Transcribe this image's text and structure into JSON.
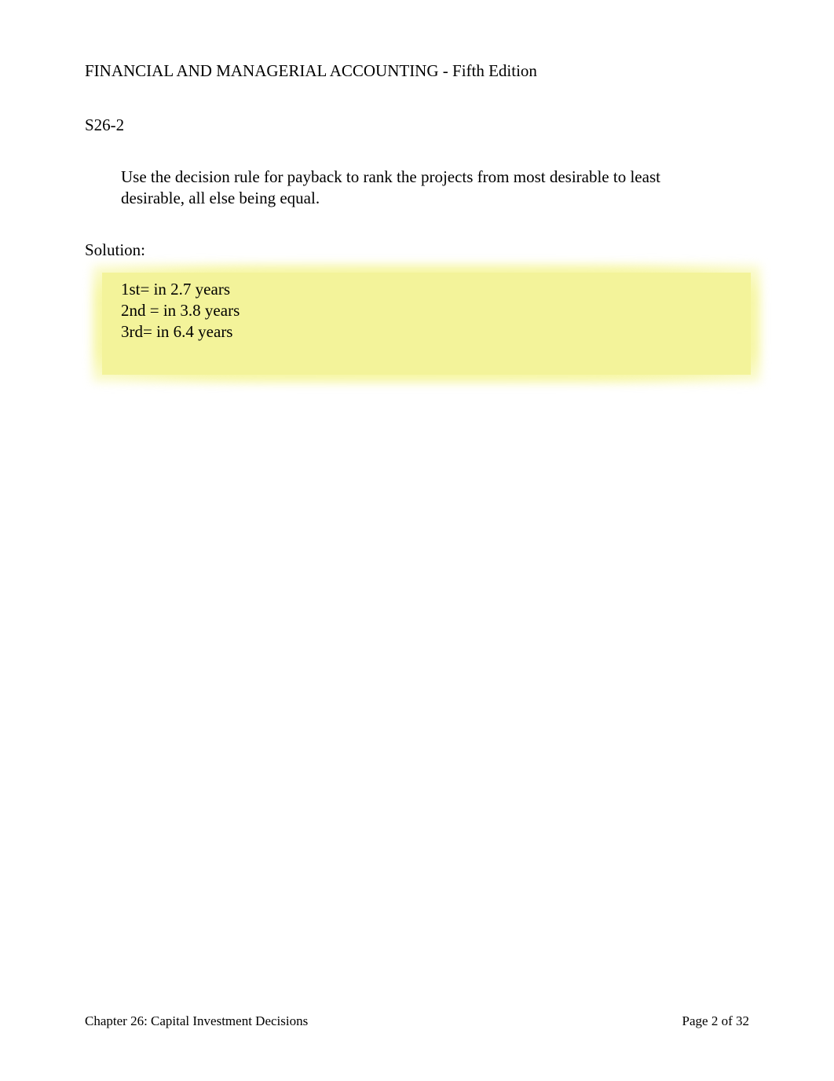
{
  "header": {
    "running_head": "FINANCIAL AND MANAGERIAL ACCOUNTING - Fifth Edition"
  },
  "problem": {
    "number": "S26-2",
    "text": "Use the decision rule for payback to rank the projects from most desirable to least desirable, all else being equal."
  },
  "solution": {
    "label": "Solution:",
    "lines": [
      "1st= in 2.7 years",
      "2nd = in 3.8 years",
      "3rd= in 6.4 years"
    ]
  },
  "footer": {
    "left": "Chapter 26: Capital Investment Decisions",
    "right": "Page 2 of 32"
  }
}
